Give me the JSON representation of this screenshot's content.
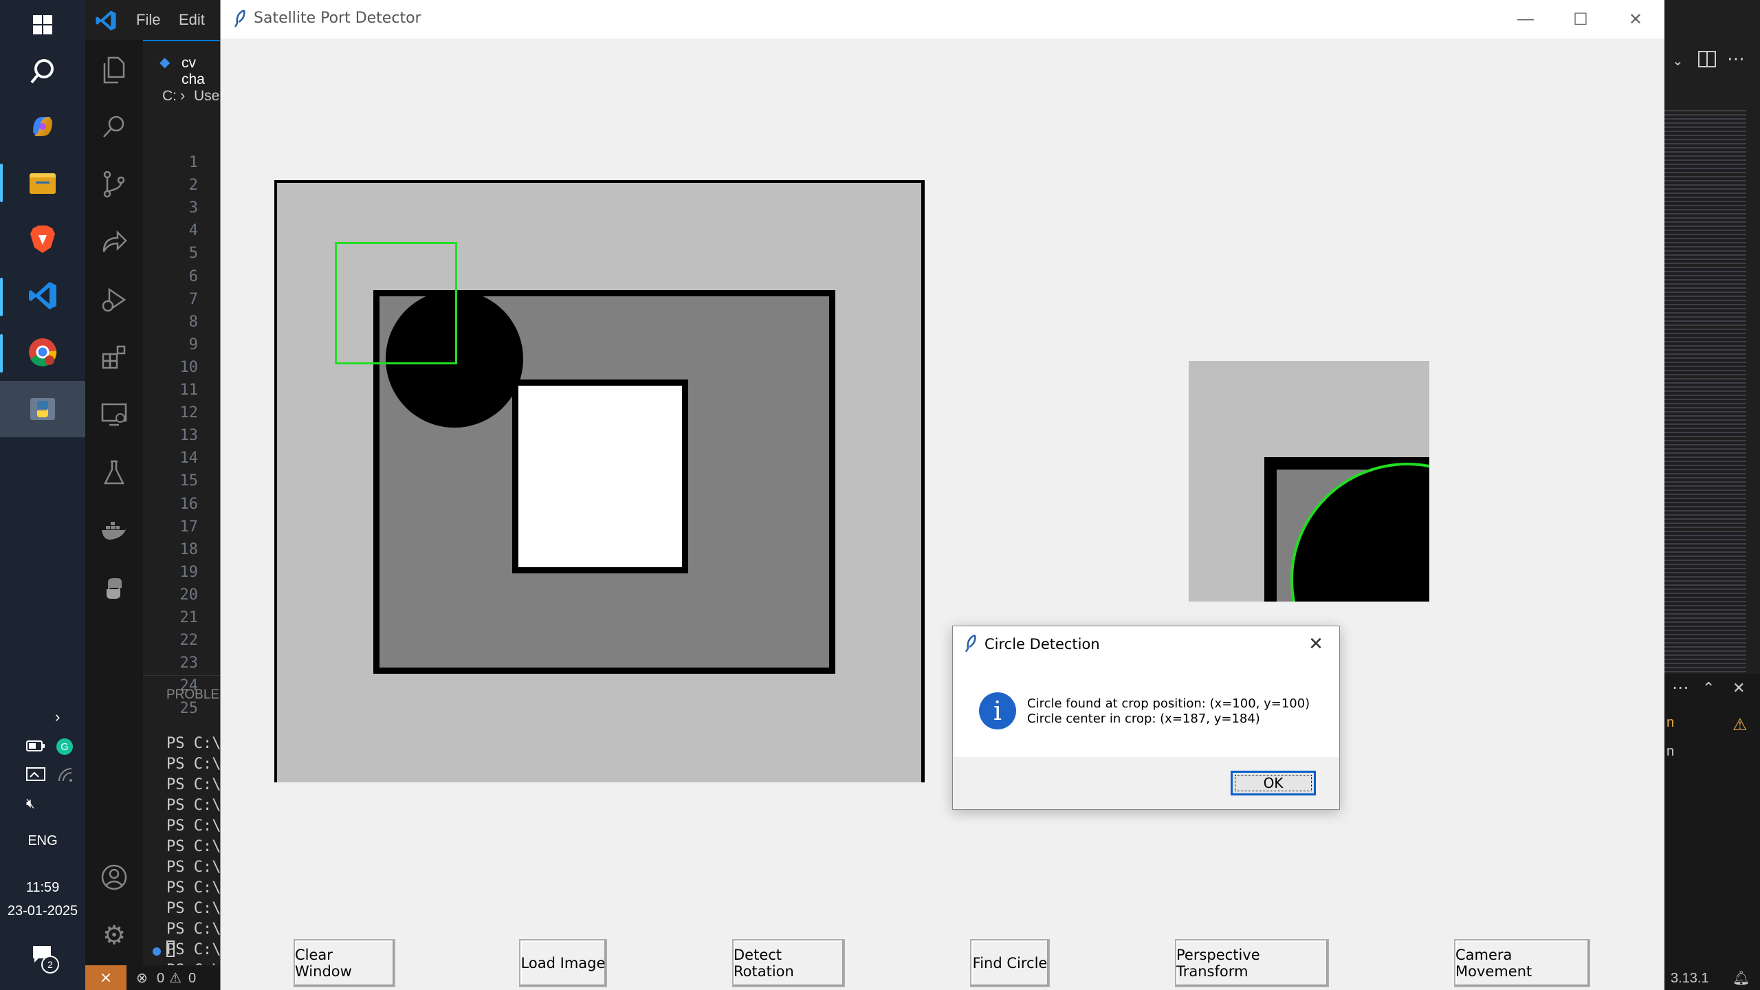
{
  "taskbar": {
    "apps": [
      "windows-start",
      "search",
      "copilot",
      "file-explorer",
      "brave",
      "vscode",
      "chrome",
      "python"
    ],
    "language": "ENG",
    "time": "11:59",
    "date": "23-01-2025",
    "notification_count": "2"
  },
  "vscode": {
    "menu": [
      "File",
      "Edit"
    ],
    "tab_label": "cv cha",
    "breadcrumb_drive": "C:",
    "breadcrumb_next": "Use",
    "line_numbers": [
      "1",
      "2",
      "3",
      "4",
      "5",
      "6",
      "7",
      "8",
      "9",
      "10",
      "11",
      "12",
      "13",
      "14",
      "15",
      "16",
      "17",
      "18",
      "19",
      "20",
      "21",
      "22",
      "23",
      "24",
      "25"
    ],
    "panel_label": "PROBLEM",
    "terminal_lines": [
      "PS C:\\",
      "PS C:\\",
      "PS C:\\",
      "PS C:\\",
      "PS C:\\",
      "PS C:\\",
      "PS C:\\",
      "PS C:\\",
      "PS C:\\",
      "PS C:\\",
      "PS C:\\",
      "PS C:\\"
    ],
    "status_errors": "0",
    "status_warnings": "0",
    "status_version": "3.13.1",
    "right_panel_text": [
      "n",
      "n"
    ]
  },
  "app": {
    "title": "Satellite Port Detector",
    "buttons": [
      "Clear Window",
      "Load Image",
      "Detect Rotation",
      "Find Circle",
      "Perspective Transform",
      "Camera Movement"
    ]
  },
  "dialog": {
    "title": "Circle Detection",
    "line1": "Circle found at crop position: (x=100, y=100)",
    "line2": "Circle center in crop: (x=187, y=184)",
    "ok_label": "OK"
  },
  "colors": {
    "detection_green": "#22dd22",
    "info_blue": "#1e64c8",
    "ok_focus_blue": "#0b5ec9",
    "vscode_accent": "#4cc2ff",
    "remote_orange": "#c5702c"
  }
}
